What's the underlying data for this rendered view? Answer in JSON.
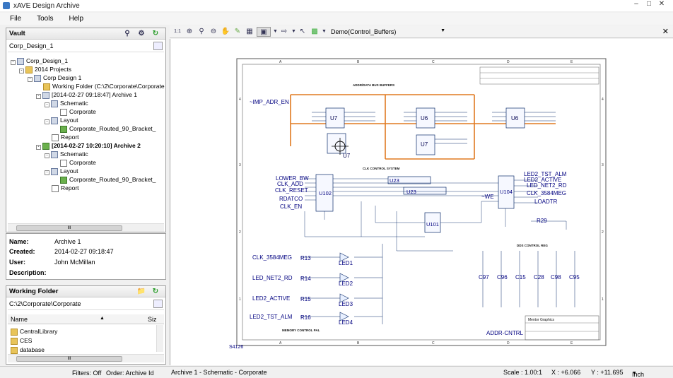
{
  "app": {
    "title": "xAVE Design Archive"
  },
  "menu": [
    "File",
    "Tools",
    "Help"
  ],
  "vault": {
    "title": "Vault",
    "location": "Corp_Design_1",
    "tree": [
      {
        "label": "Corp_Design_1"
      },
      {
        "label": "2014 Projects"
      },
      {
        "label": "Corp Design 1"
      },
      {
        "label": "Working Folder (C:\\2\\Corporate\\Corporate"
      },
      {
        "label": "[2014-02-27 09:18:47] Archive 1"
      },
      {
        "label": "Schematic"
      },
      {
        "label": "Corporate"
      },
      {
        "label": "Layout"
      },
      {
        "label": "Corporate_Routed_90_Bracket_"
      },
      {
        "label": "Report"
      },
      {
        "label": "[2014-02-27 10:20:10] Archive 2"
      },
      {
        "label": "Schematic"
      },
      {
        "label": "Corporate"
      },
      {
        "label": "Layout"
      },
      {
        "label": "Corporate_Routed_90_Bracket_"
      },
      {
        "label": "Report"
      }
    ],
    "scroll_mark": "III"
  },
  "properties": {
    "name_label": "Name:",
    "name_value": "Archive 1",
    "created_label": "Created:",
    "created_value": "2014-02-27 09:18:47",
    "user_label": "User:",
    "user_value": "John McMillan",
    "description_label": "Description:"
  },
  "working_folder": {
    "title": "Working Folder",
    "path": "C:\\2\\Corporate\\Corporate",
    "col_name": "Name",
    "col_size": "Siz",
    "files": [
      "CentralLibrary",
      "CES",
      "database"
    ],
    "scroll_mark": "III"
  },
  "left_status": {
    "filters": "Filters: Off",
    "order": "Order: Archive Id"
  },
  "toolbar": {
    "view_select": "Demo(Control_Buffers)",
    "zoom_label": "1:1"
  },
  "status": {
    "path": "Archive 1 - Schematic - Corporate",
    "scale": "Scale : 1.00:1",
    "x": "X : +6.066",
    "y": "Y : +11.695",
    "unit": "Inch"
  },
  "schematic": {
    "columns": [
      "A",
      "B",
      "C",
      "D",
      "E"
    ],
    "rows": [
      "4",
      "3",
      "2",
      "1"
    ],
    "sections": [
      "ADDR/DATA BUS BUFFERS",
      "CLK CONTROL SYSTEM",
      "DDS CONTROL REG",
      "MEMORY CONTROL PAL"
    ],
    "chips": [
      "U7",
      "U6",
      "U6",
      "U7",
      "U7",
      "U102",
      "U23",
      "U23",
      "U104",
      "U101"
    ],
    "nets_left": [
      "~IMP_ADR_EN",
      "LOWER_BW",
      "CLK_ADD",
      "CLK_RESET",
      "RDATCO",
      "CLK_EN"
    ],
    "nets_right": [
      "LED2_TST_ALM",
      "LED2_ACTIVE",
      "LED_NET2_RD",
      "CLK_3584MEG",
      "LOADTR",
      "~WE"
    ],
    "led_nets": [
      "CLK_3584MEG",
      "LED_NET2_RD",
      "LED2_ACTIVE",
      "LED2_TST_ALM"
    ],
    "resistors": [
      "R13",
      "R14",
      "R15",
      "R16",
      "R29"
    ],
    "leds": [
      "LED1",
      "LED2",
      "LED3",
      "LED4"
    ],
    "caps": [
      "C97",
      "C96",
      "C15",
      "C28",
      "C98",
      "C95"
    ],
    "title_block": "Mentor Graphics",
    "addr_label": "ADDR-CNTRL",
    "sheet_id": "S4126"
  }
}
